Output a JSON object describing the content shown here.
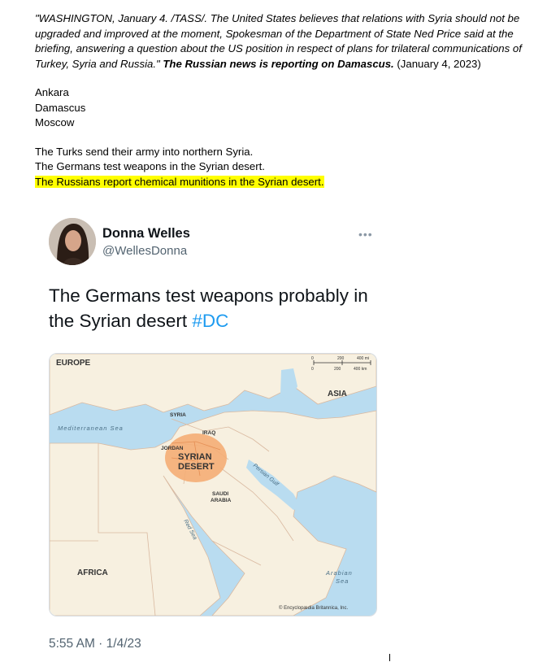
{
  "document": {
    "quote_italic": "\"WASHINGTON, January 4. /TASS/. The United States believes that relations with Syria should not be upgraded and improved at the moment, Spokesman of the Department of State Ned Price said at the briefing, answering a question about the US position in respect of plans for trilateral communications of Turkey, Syria and Russia.\"",
    "quote_bold": "The Russian news is reporting on Damascus.",
    "quote_date": "(January 4, 2023)",
    "cities": [
      "Ankara",
      "Damascus",
      "Moscow"
    ],
    "statements": [
      "The Turks send their army into northern Syria.",
      "The Germans test weapons in the Syrian desert.",
      "The Russians report chemical munitions in the Syrian desert."
    ],
    "highlight_color": "#ffff00"
  },
  "tweet": {
    "name": "Donna Welles",
    "handle": "@WellesDonna",
    "more_icon": "more-dots-icon",
    "text": "The Germans test weapons probably in the Syrian desert",
    "hashtag": "#DC",
    "hashtag_color": "#1d9bf0",
    "timestamp": "5:55 AM · 1/4/23",
    "map": {
      "labels": {
        "europe": "EUROPE",
        "asia": "ASIA",
        "mediterranean": "Mediterranean Sea",
        "syria": "SYRIA",
        "iraq": "IRAQ",
        "jordan": "JORDAN",
        "syrian_desert_1": "SYRIAN",
        "syrian_desert_2": "DESERT",
        "saudi_1": "SAUDI",
        "saudi_2": "ARABIA",
        "persian_gulf": "Persian Gulf",
        "red_sea": "Red Sea",
        "africa": "AFRICA",
        "arabian_1": "Arabian",
        "arabian_2": "Sea",
        "copyright": "© Encyclopædia Britannica, Inc.",
        "scale_0": "0",
        "scale_200": "200",
        "scale_400mi": "400 mi",
        "scale_0b": "0",
        "scale_200b": "200",
        "scale_400km": "400 km"
      },
      "sea_color": "#b9dcf0",
      "land_color": "#f7f0e0",
      "desert_color": "#f4ad76"
    }
  }
}
